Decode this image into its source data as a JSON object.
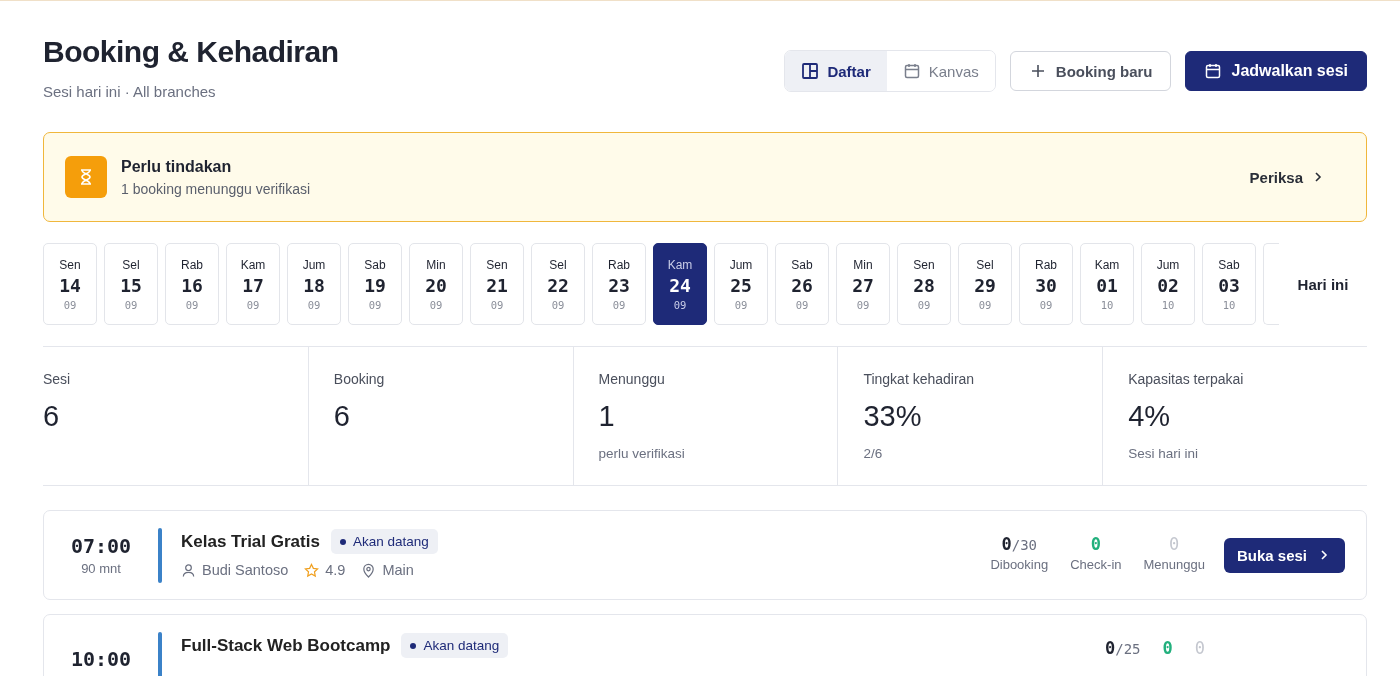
{
  "header": {
    "title": "Booking & Kehadiran",
    "subtitle": "Sesi hari ini · All branches"
  },
  "view_toggle": [
    {
      "kind": "list",
      "label": "Daftar",
      "selected": true
    },
    {
      "kind": "calendar",
      "label": "Kanvas",
      "selected": false
    }
  ],
  "buttons": [
    {
      "kind": "plus",
      "label": "Booking baru",
      "primary": false
    },
    {
      "kind": "calendar",
      "label": "Jadwalkan sesi",
      "primary": true
    }
  ],
  "alert": {
    "title": "Perlu tindakan",
    "message": "1 booking menunggu verifikasi",
    "action": "Periksa"
  },
  "dates": [
    {
      "weekday": "Sen",
      "day": "14",
      "month": "09",
      "selected": false
    },
    {
      "weekday": "Sel",
      "day": "15",
      "month": "09",
      "selected": false
    },
    {
      "weekday": "Rab",
      "day": "16",
      "month": "09",
      "selected": false
    },
    {
      "weekday": "Kam",
      "day": "17",
      "month": "09",
      "selected": false
    },
    {
      "weekday": "Jum",
      "day": "18",
      "month": "09",
      "selected": false
    },
    {
      "weekday": "Sab",
      "day": "19",
      "month": "09",
      "selected": false
    },
    {
      "weekday": "Min",
      "day": "20",
      "month": "09",
      "selected": false
    },
    {
      "weekday": "Sen",
      "day": "21",
      "month": "09",
      "selected": false
    },
    {
      "weekday": "Sel",
      "day": "22",
      "month": "09",
      "selected": false
    },
    {
      "weekday": "Rab",
      "day": "23",
      "month": "09",
      "selected": false
    },
    {
      "weekday": "Kam",
      "day": "24",
      "month": "09",
      "selected": true
    },
    {
      "weekday": "Jum",
      "day": "25",
      "month": "09",
      "selected": false
    },
    {
      "weekday": "Sab",
      "day": "26",
      "month": "09",
      "selected": false
    },
    {
      "weekday": "Min",
      "day": "27",
      "month": "09",
      "selected": false
    },
    {
      "weekday": "Sen",
      "day": "28",
      "month": "09",
      "selected": false
    },
    {
      "weekday": "Sel",
      "day": "29",
      "month": "09",
      "selected": false
    },
    {
      "weekday": "Rab",
      "day": "30",
      "month": "09",
      "selected": false
    },
    {
      "weekday": "Kam",
      "day": "01",
      "month": "10",
      "selected": false
    },
    {
      "weekday": "Jum",
      "day": "02",
      "month": "10",
      "selected": false
    },
    {
      "weekday": "Sab",
      "day": "03",
      "month": "10",
      "selected": false
    }
  ],
  "today_button": "Hari ini",
  "stats": [
    {
      "label": "Sesi",
      "value": "6"
    },
    {
      "label": "Booking",
      "value": "6"
    },
    {
      "label": "Menunggu",
      "value": "1",
      "note": "perlu verifikasi"
    },
    {
      "label": "Tingkat kehadiran",
      "value": "33%",
      "note": "2/6"
    },
    {
      "label": "Kapasitas terpakai",
      "value": "4%",
      "note": "Sesi hari ini"
    }
  ],
  "sessions": [
    {
      "time": "07:00",
      "duration": "90 mnt",
      "color": "#3b82c8",
      "title": "Kelas Trial Gratis",
      "status": "Akan datang",
      "instructor": "Budi Santoso",
      "rating": "4.9",
      "location": "Main",
      "booked": "0",
      "capacity": "/30",
      "booked_label": "Dibooking",
      "checkin": "0",
      "checkin_label": "Check-in",
      "waiting": "0",
      "waiting_label": "Menunggu",
      "action": "Buka sesi"
    },
    {
      "time": "10:00",
      "color": "#3b82c8",
      "title": "Full-Stack Web Bootcamp",
      "status": "Akan datang",
      "booked": "0",
      "capacity": "/25",
      "checkin": "0",
      "waiting": "0"
    }
  ]
}
